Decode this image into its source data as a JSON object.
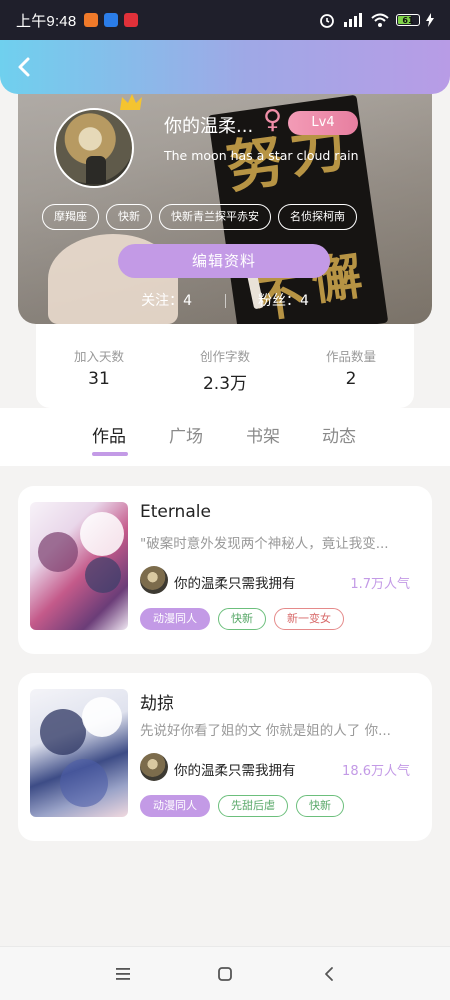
{
  "status_bar": {
    "time": "上午9:48",
    "battery": "61"
  },
  "profile": {
    "username": "你的温柔...",
    "gender_symbol": "♀",
    "level": "Lv4",
    "signature": "The moon has a star cloud rain",
    "tags": [
      "摩羯座",
      "快新",
      "快新青兰探平赤安",
      "名侦探柯南"
    ],
    "edit_label": "编辑资料",
    "following_label": "关注：4",
    "followers_label": "粉丝：4"
  },
  "stats": [
    {
      "label": "加入天数",
      "value": "31"
    },
    {
      "label": "创作字数",
      "value": "2.3万"
    },
    {
      "label": "作品数量",
      "value": "2"
    }
  ],
  "tabs": [
    "作品",
    "广场",
    "书架",
    "动态"
  ],
  "works": [
    {
      "title": "Eternale",
      "description": "\"破案时意外发现两个神秘人，竟让我变...",
      "author": "你的温柔只需我拥有",
      "popularity": "1.7万人气",
      "tags": [
        "动漫同人",
        "快新",
        "新一变女"
      ]
    },
    {
      "title": "劫掠",
      "description": "先说好你看了姐的文 你就是姐的人了 你...",
      "author": "你的温柔只需我拥有",
      "popularity": "18.6万人气",
      "tags": [
        "动漫同人",
        "先甜后虐",
        "快新"
      ]
    }
  ],
  "colors": {
    "accent": "#c39ae6",
    "level": "#e77fa0",
    "tag_green": "#6cbf7c",
    "tag_red": "#e58a8a"
  },
  "icons": {
    "back": "chevron-left-icon",
    "menu": "menu-icon",
    "home": "home-icon",
    "nav_back": "back-icon"
  }
}
